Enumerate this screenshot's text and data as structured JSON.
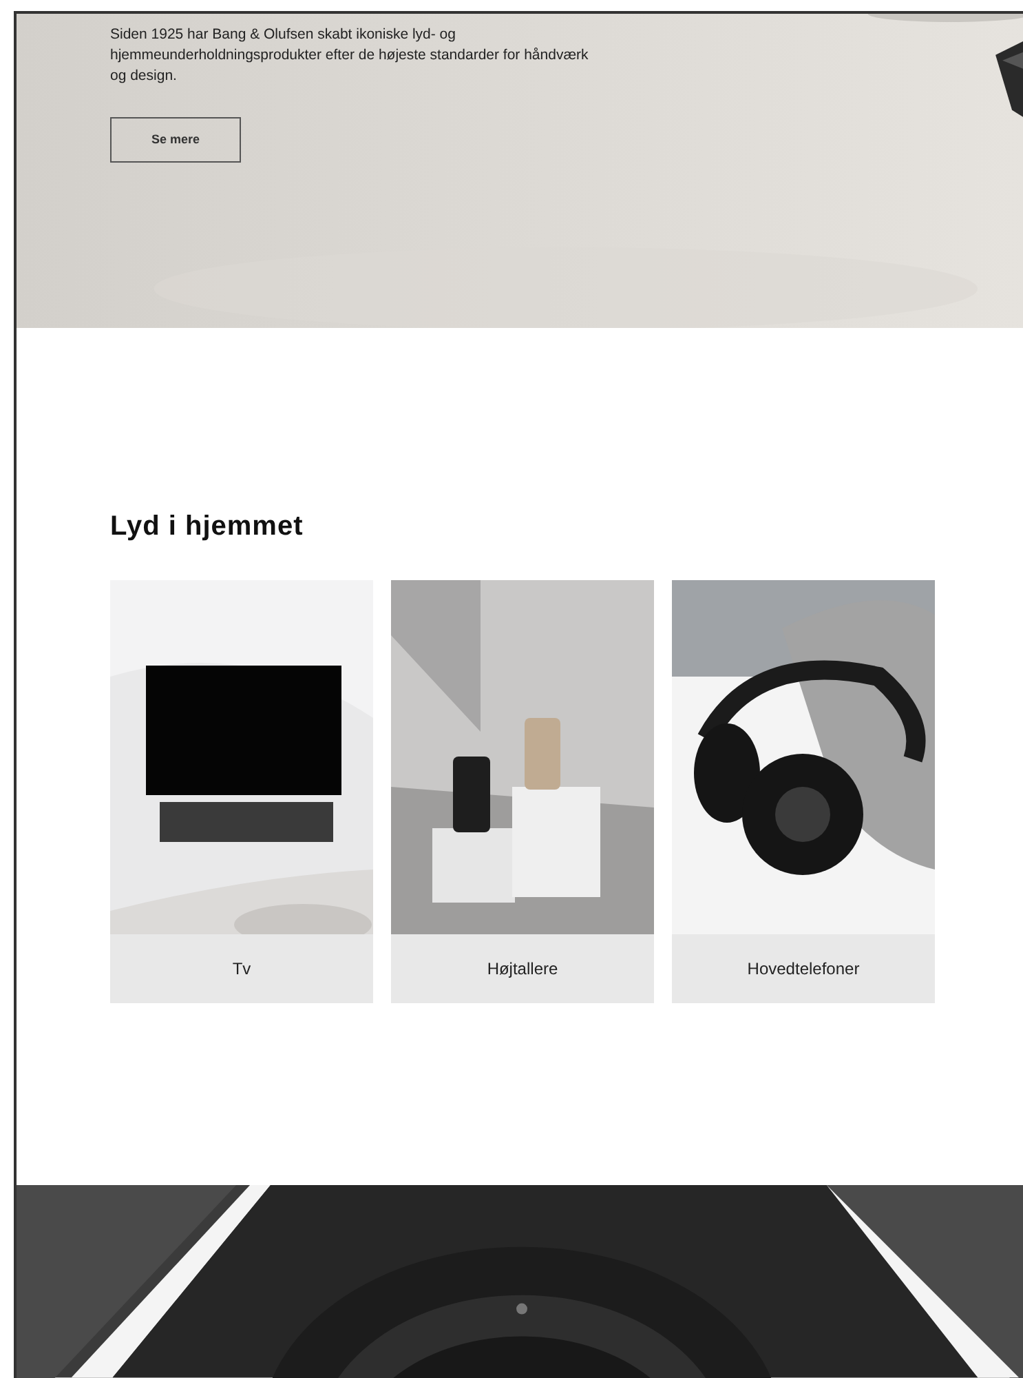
{
  "hero": {
    "text": "Siden 1925 har Bang & Olufsen skabt ikoniske lyd- og hjemmeunderholdningsprodukter efter de højeste standarder for håndværk og design.",
    "button": "Se mere"
  },
  "section": {
    "title": "Lyd i hjemmet",
    "cards": [
      {
        "kind": "tv",
        "label": "Tv"
      },
      {
        "kind": "speakers",
        "label": "Højtallere"
      },
      {
        "kind": "headphones",
        "label": "Hovedtelefoner"
      }
    ]
  }
}
